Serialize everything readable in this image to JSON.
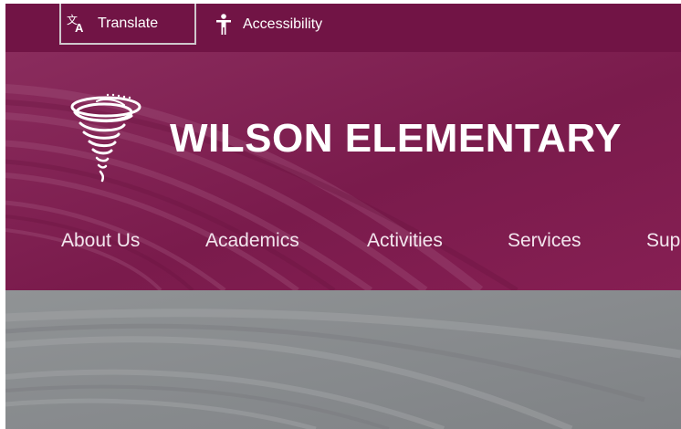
{
  "utility": {
    "translate": {
      "label": "Translate",
      "icon": "translate-icon"
    },
    "accessibility": {
      "label": "Accessibility",
      "icon": "accessibility-icon"
    }
  },
  "header": {
    "school_name": "WILSON ELEMENTARY",
    "logo_icon": "tornado-logo-icon"
  },
  "nav": {
    "items": [
      {
        "label": "About Us"
      },
      {
        "label": "Academics"
      },
      {
        "label": "Activities"
      },
      {
        "label": "Services"
      },
      {
        "label": "Sup"
      }
    ]
  },
  "colors": {
    "utility_bar": "#711445",
    "header": "#86275a",
    "hero": "#8b8e91",
    "text": "#ffffff"
  }
}
